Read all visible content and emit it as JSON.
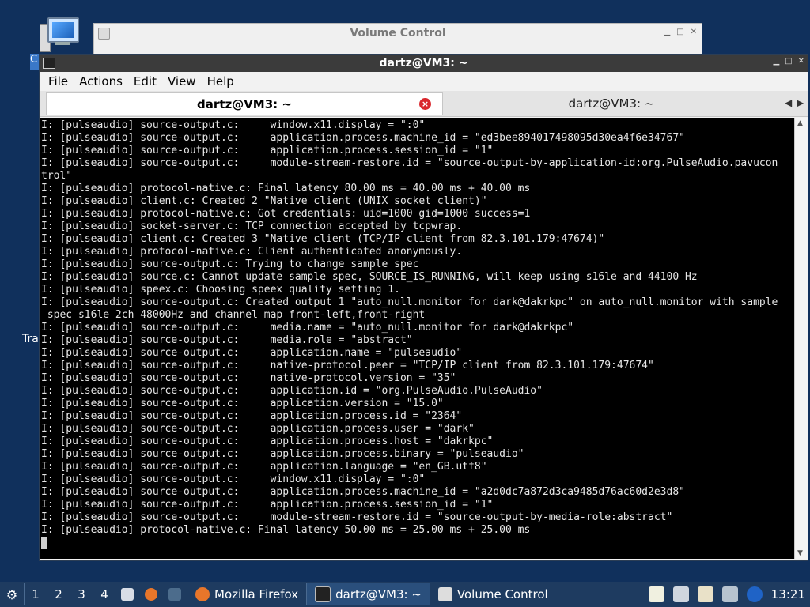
{
  "desktop": {
    "trash_label_fragment": "Tra",
    "c_label_fragment": "C"
  },
  "volume_window": {
    "title": "Volume Control"
  },
  "terminal": {
    "window_title": "dartz@VM3: ~",
    "menu": [
      "File",
      "Actions",
      "Edit",
      "View",
      "Help"
    ],
    "tabs": [
      {
        "label": "dartz@VM3: ~",
        "active": true
      },
      {
        "label": "dartz@VM3: ~",
        "active": false
      }
    ],
    "lines": [
      "I: [pulseaudio] source-output.c:     window.x11.display = \":0\"",
      "I: [pulseaudio] source-output.c:     application.process.machine_id = \"ed3bee894017498095d30ea4f6e34767\"",
      "I: [pulseaudio] source-output.c:     application.process.session_id = \"1\"",
      "I: [pulseaudio] source-output.c:     module-stream-restore.id = \"source-output-by-application-id:org.PulseAudio.pavucon",
      "trol\"",
      "I: [pulseaudio] protocol-native.c: Final latency 80.00 ms = 40.00 ms + 40.00 ms",
      "I: [pulseaudio] client.c: Created 2 \"Native client (UNIX socket client)\"",
      "I: [pulseaudio] protocol-native.c: Got credentials: uid=1000 gid=1000 success=1",
      "I: [pulseaudio] socket-server.c: TCP connection accepted by tcpwrap.",
      "I: [pulseaudio] client.c: Created 3 \"Native client (TCP/IP client from 82.3.101.179:47674)\"",
      "I: [pulseaudio] protocol-native.c: Client authenticated anonymously.",
      "I: [pulseaudio] source-output.c: Trying to change sample spec",
      "I: [pulseaudio] source.c: Cannot update sample spec, SOURCE_IS_RUNNING, will keep using s16le and 44100 Hz",
      "I: [pulseaudio] speex.c: Choosing speex quality setting 1.",
      "I: [pulseaudio] source-output.c: Created output 1 \"auto_null.monitor for dark@dakrkpc\" on auto_null.monitor with sample",
      " spec s16le 2ch 48000Hz and channel map front-left,front-right",
      "I: [pulseaudio] source-output.c:     media.name = \"auto_null.monitor for dark@dakrkpc\"",
      "I: [pulseaudio] source-output.c:     media.role = \"abstract\"",
      "I: [pulseaudio] source-output.c:     application.name = \"pulseaudio\"",
      "I: [pulseaudio] source-output.c:     native-protocol.peer = \"TCP/IP client from 82.3.101.179:47674\"",
      "I: [pulseaudio] source-output.c:     native-protocol.version = \"35\"",
      "I: [pulseaudio] source-output.c:     application.id = \"org.PulseAudio.PulseAudio\"",
      "I: [pulseaudio] source-output.c:     application.version = \"15.0\"",
      "I: [pulseaudio] source-output.c:     application.process.id = \"2364\"",
      "I: [pulseaudio] source-output.c:     application.process.user = \"dark\"",
      "I: [pulseaudio] source-output.c:     application.process.host = \"dakrkpc\"",
      "I: [pulseaudio] source-output.c:     application.process.binary = \"pulseaudio\"",
      "I: [pulseaudio] source-output.c:     application.language = \"en_GB.utf8\"",
      "I: [pulseaudio] source-output.c:     window.x11.display = \":0\"",
      "I: [pulseaudio] source-output.c:     application.process.machine_id = \"a2d0dc7a872d3ca9485d76ac60d2e3d8\"",
      "I: [pulseaudio] source-output.c:     application.process.session_id = \"1\"",
      "I: [pulseaudio] source-output.c:     module-stream-restore.id = \"source-output-by-media-role:abstract\"",
      "I: [pulseaudio] protocol-native.c: Final latency 50.00 ms = 25.00 ms + 25.00 ms"
    ]
  },
  "taskbar": {
    "workspaces": [
      "1",
      "2",
      "3",
      "4"
    ],
    "tasks": [
      {
        "label": "Mozilla Firefox",
        "icon": "firefox-icon"
      },
      {
        "label": "dartz@VM3: ~",
        "icon": "terminal-icon"
      },
      {
        "label": "Volume Control",
        "icon": "volume-control-icon"
      }
    ],
    "clock": "13:21"
  }
}
